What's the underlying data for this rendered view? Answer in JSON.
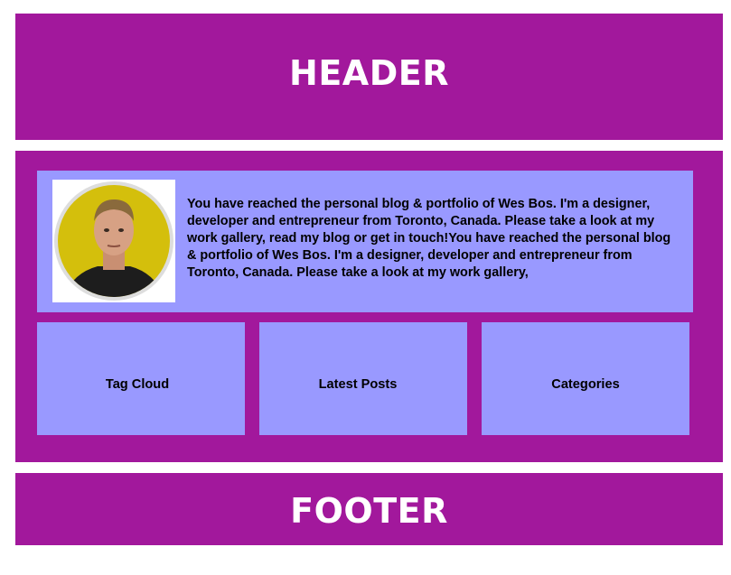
{
  "header": {
    "title": "HEADER"
  },
  "intro": {
    "bio": "You have reached the personal blog & portfolio of Wes Bos. I'm a designer, developer and entrepreneur from Toronto, Canada. Please take a look at my work gallery, read my blog or get in touch!You have reached the personal blog & portfolio of Wes Bos. I'm a designer, developer and entrepreneur from Toronto, Canada. Please take a look at my work gallery,"
  },
  "widgets": [
    {
      "label": "Tag Cloud"
    },
    {
      "label": "Latest Posts"
    },
    {
      "label": "Categories"
    }
  ],
  "footer": {
    "title": "FOOTER"
  },
  "colors": {
    "brand": "#a2189c",
    "panel": "#9999ff"
  }
}
